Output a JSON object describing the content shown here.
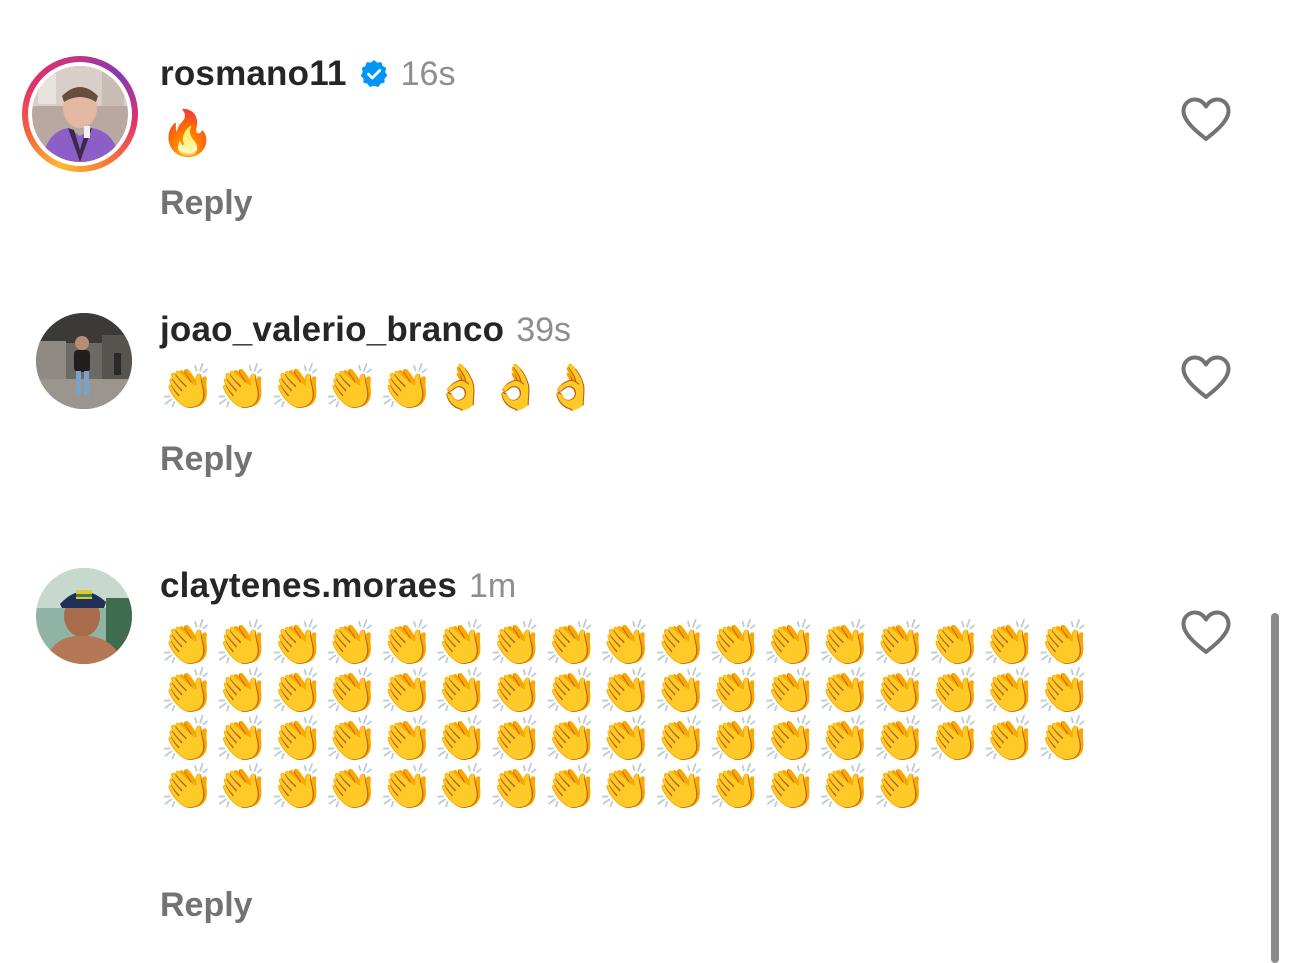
{
  "comments": [
    {
      "username": "rosmano11",
      "verified": true,
      "timestamp": "16s",
      "text": "🔥",
      "reply_label": "Reply",
      "has_story_ring": true
    },
    {
      "username": "joao_valerio_branco",
      "verified": false,
      "timestamp": "39s",
      "text": "👏👏👏👏👏👌👌👌",
      "reply_label": "Reply",
      "has_story_ring": false
    },
    {
      "username": "claytenes.moraes",
      "verified": false,
      "timestamp": "1m",
      "text": "👏👏👏👏👏👏👏👏👏👏👏👏👏👏👏👏👏👏👏👏👏👏👏👏👏👏👏👏👏👏👏👏👏👏👏👏👏👏👏👏👏👏👏👏👏👏👏👏👏👏👏👏👏👏👏👏👏👏👏👏👏👏👏👏👏",
      "reply_label": "Reply",
      "has_story_ring": false
    }
  ],
  "icons": {
    "like": "heart-outline-icon",
    "verified": "verified-badge-icon"
  },
  "colors": {
    "username": "#262626",
    "timestamp": "#8e8e8e",
    "reply": "#737373",
    "verified": "#0095f6"
  }
}
